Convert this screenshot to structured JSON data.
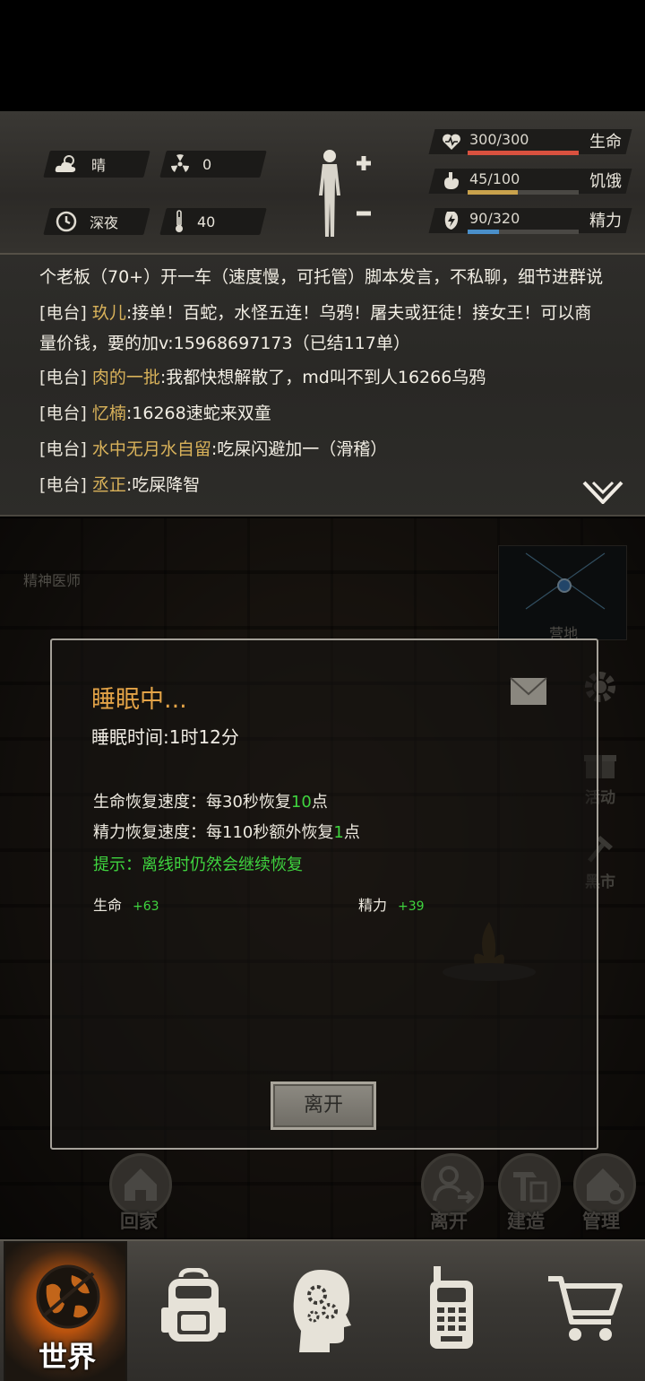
{
  "status": {
    "weather": "晴",
    "radiation": "0",
    "time_of_day": "深夜",
    "temperature": "40",
    "life": {
      "text": "300/300",
      "label": "生命",
      "fill": 1.0,
      "color": "#d9513f"
    },
    "hunger": {
      "text": "45/100",
      "label": "饥饿",
      "fill": 0.45,
      "color": "#c9a24c"
    },
    "energy": {
      "text": "90/320",
      "label": "精力",
      "fill": 0.28,
      "color": "#4a8fc9"
    }
  },
  "chat": {
    "line0": {
      "msg": "个老板（70+）开一车（速度慢，可托管）脚本发言，不私聊，细节进群说"
    },
    "line1": {
      "tag": "[电台]",
      "name": "玖儿",
      "msg": ":接单！百蛇，水怪五连！乌鸦！屠夫或狂徒！接女王！可以商"
    },
    "line1b": {
      "msg": "量价钱，要的加v:15968697173（已结117单）"
    },
    "line2": {
      "tag": "[电台]",
      "name": "肉的一批",
      "msg": ":我都快想解散了，md叫不到人16266乌鸦"
    },
    "line3": {
      "tag": "[电台]",
      "name": "忆楠",
      "msg": ":16268速蛇来双童"
    },
    "line4": {
      "tag": "[电台]",
      "name": "水中无月水自留",
      "msg": ":吃屎闪避加一（滑稽）"
    },
    "line5": {
      "tag": "[电台]",
      "name": "丞正",
      "msg": ":吃屎降智"
    }
  },
  "scene": {
    "npc_label": "精神医师",
    "camp_label": "营地",
    "side_activity": "活动",
    "side_market": "黑市",
    "btn_home": "回家",
    "btn_leave": "离开",
    "btn_build": "建造",
    "btn_manage": "管理"
  },
  "dialog": {
    "title": "睡眠中...",
    "sleep_time": "睡眠时间:1时12分",
    "life_rate_prefix": "生命恢复速度：每30秒恢复",
    "life_rate_value": "10",
    "life_rate_suffix": "点",
    "energy_rate_prefix": "精力恢复速度：每110秒额外恢复",
    "energy_rate_value": "1",
    "energy_rate_suffix": "点",
    "hint": "提示：离线时仍然会继续恢复",
    "gain_life_label": "生命",
    "gain_life_value": "+63",
    "gain_energy_label": "精力",
    "gain_energy_value": "+39",
    "leave_button": "离开"
  },
  "tabs": {
    "world": "世界",
    "icons": [
      "globe-icon",
      "backpack-icon",
      "brain-head-icon",
      "walkie-talkie-icon",
      "shopping-cart-icon"
    ]
  }
}
